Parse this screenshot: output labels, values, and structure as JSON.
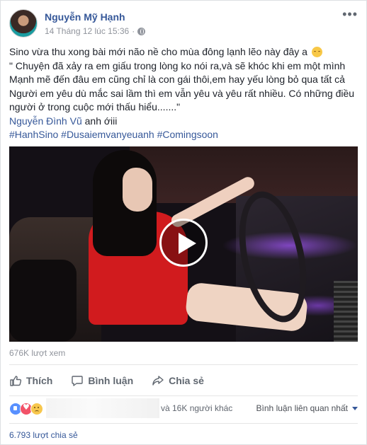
{
  "post": {
    "author": "Nguyễn Mỹ Hạnh",
    "timestamp": "14 Tháng 12 lúc 15:36",
    "privacy_icon": "globe-icon",
    "more_label": "•••",
    "lines": [
      "Sino vừa thu xong bài mới não nề cho mùa đông lạnh lẽo này đây a",
      "\" Chuyện đã xảy ra em giấu trong lòng ko nói ra,và sẽ khóc khi em một mình",
      "Mạnh mẽ đến đâu em cũng chỉ là con gái thôi,em hay yếu lòng bỏ qua tất cả",
      "Người em yêu dù mắc sai lầm thì em vẫn yêu và yêu rất nhiều. Có những điều",
      "người ở trong cuộc mới thấu hiểu.......\""
    ],
    "mention": "Nguyễn Đình Vũ",
    "mention_suffix": " anh ới​ii",
    "hashtags": "#HanhSino #Dusaiemvanyeuanh #Comingsoon",
    "views": "676K lượt xem"
  },
  "actions": {
    "like": "Thích",
    "comment": "Bình luận",
    "share": "Chia sẻ"
  },
  "reactions": {
    "others": "và 16K người khác",
    "sort_label": "Bình luận liên quan nhất"
  },
  "shares": "6.793 lượt chia sẻ"
}
